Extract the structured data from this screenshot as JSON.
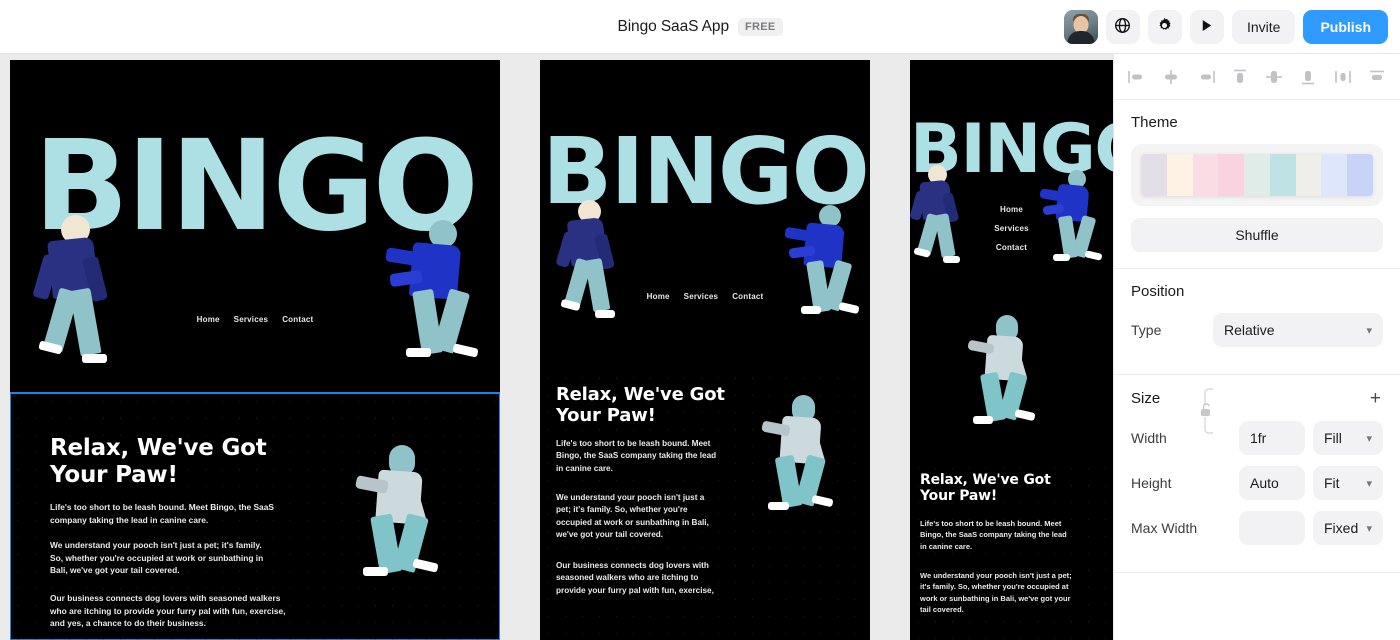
{
  "topbar": {
    "title": "Bingo SaaS App",
    "badge": "FREE",
    "avatar_name": "user-avatar",
    "globe_icon": "globe-icon",
    "gear_icon": "gear-icon",
    "play_icon": "play-icon",
    "invite_label": "Invite",
    "publish_label": "Publish",
    "publish_color": "#2f9bff"
  },
  "panel": {
    "align_icons": [
      "align-left-icon",
      "align-center-horizontal-icon",
      "align-right-icon",
      "align-top-icon",
      "align-center-vertical-icon",
      "align-bottom-icon",
      "distribute-horizontal-icon",
      "distribute-vertical-icon"
    ],
    "theme": {
      "title": "Theme",
      "shuffle_label": "Shuffle",
      "swatches": [
        "#e3dee7",
        "#fdf2e3",
        "#fadde4",
        "#f9d3e0",
        "#e0ece8",
        "#bfe3e4",
        "#efefe9",
        "#dde6fb",
        "#c8d4f7"
      ]
    },
    "position": {
      "title": "Position",
      "type_label": "Type",
      "type_value": "Relative"
    },
    "size": {
      "title": "Size",
      "add_label": "+",
      "link_icon": "unlock-link-icon",
      "rows": [
        {
          "label": "Width",
          "value": "1fr",
          "mode": "Fill"
        },
        {
          "label": "Height",
          "value": "Auto",
          "mode": "Fit"
        },
        {
          "label": "Max Width",
          "value": "",
          "mode": "Fixed"
        }
      ]
    }
  },
  "canvas": {
    "background": "#ebebeb",
    "selection_color": "#1a87e8",
    "artboards": [
      {
        "name": "desktop",
        "wordmark": "BINGO",
        "nav": [
          "Home",
          "Services",
          "Contact"
        ],
        "heading": "Relax, We've Got Your Paw!",
        "paragraphs": [
          "Life's too short to be leash bound. Meet Bingo, the SaaS company taking the lead in canine care.",
          "We understand your pooch isn't just a pet; it's family. So, whether you're occupied at work or sunbathing in Bali, we've got your tail covered.",
          "Our business connects dog lovers with seasoned walkers who are itching to provide your furry pal with fun, exercise, and yes, a chance to do their business."
        ]
      },
      {
        "name": "tablet",
        "wordmark": "BINGO",
        "nav": [
          "Home",
          "Services",
          "Contact"
        ],
        "heading": "Relax, We've Got Your Paw!",
        "paragraphs": [
          "Life's too short to be leash bound. Meet Bingo, the SaaS company taking the lead in canine care.",
          "We understand your pooch isn't just a pet; it's family. So, whether you're occupied at work or sunbathing in Bali, we've got your tail covered.",
          "Our business connects dog lovers with seasoned walkers who are itching to provide your furry pal with fun, exercise,"
        ]
      },
      {
        "name": "mobile",
        "wordmark": "BINGO",
        "nav": [
          "Home",
          "Services",
          "Contact"
        ],
        "heading": "Relax, We've Got Your Paw!",
        "paragraphs": [
          "Life's too short to be leash bound. Meet Bingo, the SaaS company taking the lead in canine care.",
          "We understand your pooch isn't just a pet; it's family. So, whether you're occupied at work or sunbathing in Bali, we've got your tail covered."
        ]
      }
    ]
  }
}
